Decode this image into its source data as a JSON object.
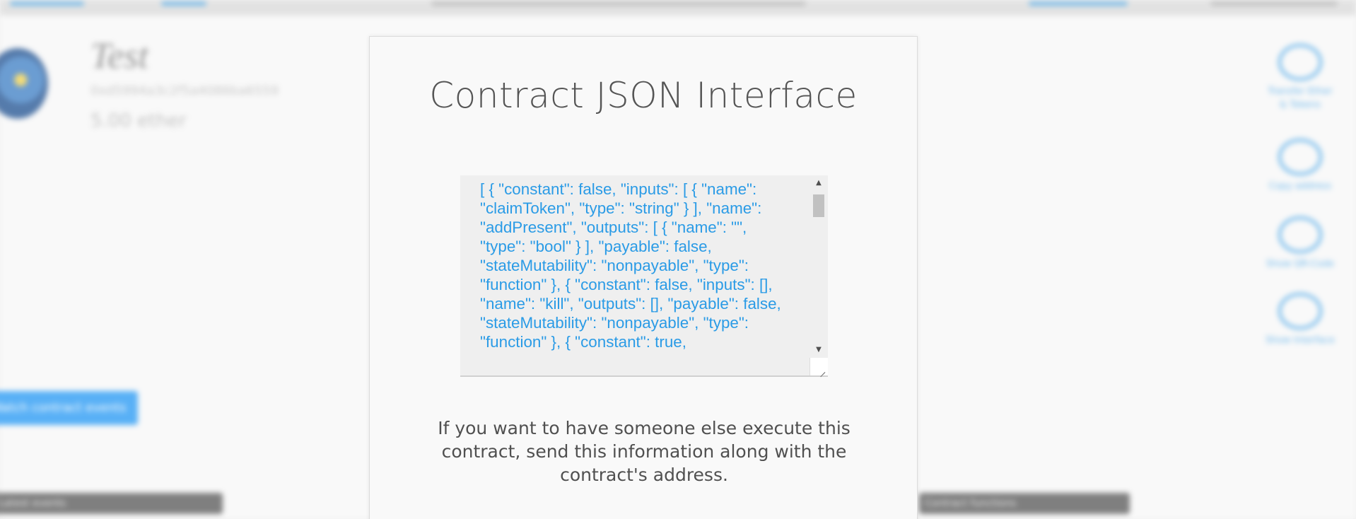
{
  "background": {
    "account_title": "Test",
    "account_address": "0xd5994a3c2f5a4086ba6559",
    "account_balance": "5.00 ether",
    "watch_button_label": "Watch contract events",
    "bar_left_label": "Latest events",
    "bar_right_label": "Contract functions",
    "side_actions": [
      {
        "icon": "transfer-icon",
        "label": "Transfer Ether & Tokens"
      },
      {
        "icon": "copy-icon",
        "label": "Copy address"
      },
      {
        "icon": "qr-code-icon",
        "label": "Show QR-Code"
      },
      {
        "icon": "interface-icon",
        "label": "Show Interface"
      }
    ]
  },
  "modal": {
    "title": "Contract JSON Interface",
    "json_text": "[ { \"constant\": false, \"inputs\": [ { \"name\": \"claimToken\", \"type\": \"string\" } ], \"name\": \"addPresent\", \"outputs\": [ { \"name\": \"\", \"type\": \"bool\" } ], \"payable\": false, \"stateMutability\": \"nonpayable\", \"type\": \"function\" }, { \"constant\": false, \"inputs\": [], \"name\": \"kill\", \"outputs\": [], \"payable\": false, \"stateMutability\": \"nonpayable\", \"type\": \"function\" }, { \"constant\": true,",
    "info_text": "If you want to have someone else execute this contract, send this information along with the contract's address."
  },
  "colors": {
    "accent": "#2a9be6",
    "title_text": "#555555",
    "body_text": "#505050",
    "modal_bg": "#f9f9f9"
  }
}
